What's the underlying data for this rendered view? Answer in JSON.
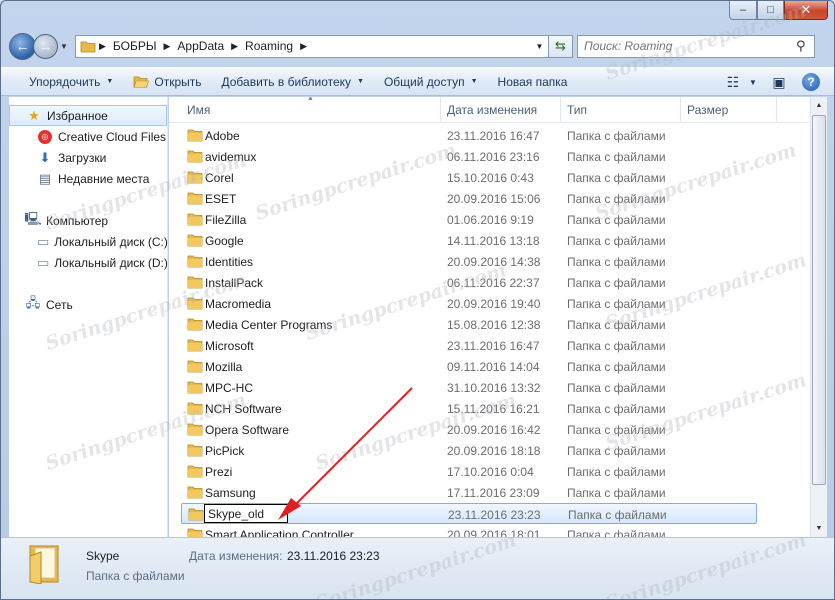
{
  "window": {
    "caption": {
      "minimize": "–",
      "maximize": "□",
      "close": "✕"
    }
  },
  "address": {
    "crumbs": [
      "БОБРЫ",
      "AppData",
      "Roaming"
    ],
    "search_placeholder": "Поиск: Roaming"
  },
  "toolbar": {
    "organize": "Упорядочить",
    "open": "Открыть",
    "add_library": "Добавить в библиотеку",
    "share": "Общий доступ",
    "new_folder": "Новая папка"
  },
  "nav": {
    "favorites": "Избранное",
    "creative_cloud": "Creative Cloud Files",
    "downloads": "Загрузки",
    "recent": "Недавние места",
    "computer": "Компьютер",
    "disk_c": "Локальный диск (C:)",
    "disk_d": "Локальный диск (D:)",
    "network": "Сеть"
  },
  "columns": {
    "name": "Имя",
    "date": "Дата изменения",
    "type": "Тип",
    "size": "Размер"
  },
  "files": [
    {
      "name": "Adobe",
      "date": "23.11.2016 16:47",
      "type": "Папка с файлами"
    },
    {
      "name": "avidemux",
      "date": "06.11.2016 23:16",
      "type": "Папка с файлами"
    },
    {
      "name": "Corel",
      "date": "15.10.2016 0:43",
      "type": "Папка с файлами"
    },
    {
      "name": "ESET",
      "date": "20.09.2016 15:06",
      "type": "Папка с файлами"
    },
    {
      "name": "FileZilla",
      "date": "01.06.2016 9:19",
      "type": "Папка с файлами"
    },
    {
      "name": "Google",
      "date": "14.11.2016 13:18",
      "type": "Папка с файлами"
    },
    {
      "name": "Identities",
      "date": "20.09.2016 14:38",
      "type": "Папка с файлами"
    },
    {
      "name": "InstallPack",
      "date": "06.11.2016 22:37",
      "type": "Папка с файлами"
    },
    {
      "name": "Macromedia",
      "date": "20.09.2016 19:40",
      "type": "Папка с файлами"
    },
    {
      "name": "Media Center Programs",
      "date": "15.08.2016 12:38",
      "type": "Папка с файлами"
    },
    {
      "name": "Microsoft",
      "date": "23.11.2016 16:47",
      "type": "Папка с файлами"
    },
    {
      "name": "Mozilla",
      "date": "09.11.2016 14:04",
      "type": "Папка с файлами"
    },
    {
      "name": "MPC-HC",
      "date": "31.10.2016 13:32",
      "type": "Папка с файлами"
    },
    {
      "name": "NCH Software",
      "date": "15.11.2016 16:21",
      "type": "Папка с файлами"
    },
    {
      "name": "Opera Software",
      "date": "20.09.2016 16:42",
      "type": "Папка с файлами"
    },
    {
      "name": "PicPick",
      "date": "20.09.2016 18:18",
      "type": "Папка с файлами"
    },
    {
      "name": "Prezi",
      "date": "17.10.2016 0:04",
      "type": "Папка с файлами"
    },
    {
      "name": "Samsung",
      "date": "17.11.2016 23:09",
      "type": "Папка с файлами"
    },
    {
      "name": "Skype_old",
      "date": "23.11.2016 23:23",
      "type": "Папка с файлами",
      "renaming": true
    },
    {
      "name": "Smart Application Controller",
      "date": "20.09.2016 18:01",
      "type": "Папка с файлами"
    }
  ],
  "details": {
    "name": "Skype",
    "type": "Папка с файлами",
    "date_label": "Дата изменения:",
    "date_value": "23.11.2016 23:23"
  },
  "watermark": "Soringpcrepair.com",
  "colors": {
    "folder": "#e8b94a",
    "selection_border": "#84acdd",
    "annotation_arrow": "#e02020"
  }
}
